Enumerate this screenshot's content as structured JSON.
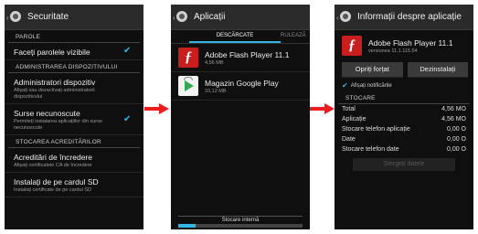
{
  "colors": {
    "accent": "#33b5e5",
    "arrow": "#ee1c1c",
    "background": "#0f0f0f"
  },
  "screen1": {
    "title": "Securitate",
    "sections": {
      "passwords": "PAROLE",
      "device_admin": "ADMINISTRAREA DISPOZITIVULUI",
      "credential_storage": "STOCAREA ACREDITĂRILOR"
    },
    "items": {
      "visible_passwords": {
        "title": "Faceți parolele vizibile"
      },
      "device_admins": {
        "title": "Administratori dispozitiv",
        "subtitle": "Afișați sau dezactivați administratorii dispozitivului"
      },
      "unknown_sources": {
        "title": "Surse necunoscute",
        "subtitle": "Permiteți instalarea aplicațiilor din surse necunoscute"
      },
      "trusted_credentials": {
        "title": "Acreditări de încredere",
        "subtitle": "Afișați certificatele CA de încredere"
      },
      "install_sd": {
        "title": "Instalați de pe cardul SD",
        "subtitle": "Instalați certificate de pe cardul SD"
      }
    }
  },
  "screen2": {
    "title": "Aplicații",
    "tabs": {
      "active": "DESCĂRCATE",
      "next": "RULEAZĂ"
    },
    "apps": [
      {
        "name": "Adobe Flash Player 11.1",
        "size": "4,56 MB",
        "icon": "flash-icon"
      },
      {
        "name": "Magazin Google Play",
        "size": "10,12 MB",
        "icon": "play-store-icon"
      }
    ],
    "storage": {
      "label": "Stocare internă",
      "used_fraction": 0.14
    }
  },
  "screen3": {
    "title": "Informații despre aplicație",
    "app_name": "Adobe Flash Player 11.1",
    "app_version": "versiunea 11.1.115.54",
    "buttons": {
      "force_stop": "Opriți forțat",
      "uninstall": "Dezinstalați",
      "clear_data": "Ștergeți datele"
    },
    "notifications_label": "Afișați notificările",
    "storage_header": "STOCARE",
    "storage_rows": [
      {
        "label": "Total",
        "value": "4,56 MO"
      },
      {
        "label": "Aplicație",
        "value": "4,56 MO"
      },
      {
        "label": "Stocare telefon aplicație",
        "value": "0,00 O"
      },
      {
        "label": "Date",
        "value": "0,00 O"
      },
      {
        "label": "Stocare telefon date",
        "value": "0,00 O"
      }
    ]
  }
}
